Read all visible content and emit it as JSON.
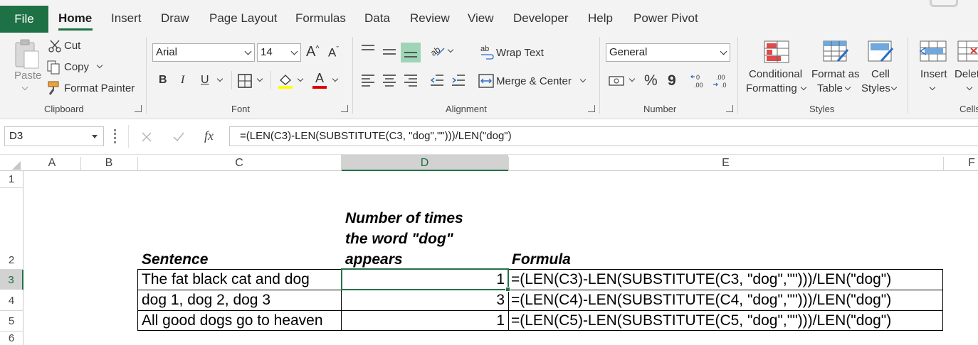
{
  "tabs": [
    "File",
    "Home",
    "Insert",
    "Draw",
    "Page Layout",
    "Formulas",
    "Data",
    "Review",
    "View",
    "Developer",
    "Help",
    "Power Pivot"
  ],
  "ribbon": {
    "clipboard": {
      "paste": "Paste",
      "cut": "Cut",
      "copy": "Copy",
      "format_painter": "Format Painter",
      "label": "Clipboard"
    },
    "font": {
      "name": "Arial",
      "size": "14",
      "bold": "B",
      "italic": "I",
      "underline": "U",
      "font_color_glyph": "A",
      "label": "Font"
    },
    "alignment": {
      "wrap_text": "Wrap Text",
      "merge_center": "Merge & Center",
      "label": "Alignment"
    },
    "number": {
      "format": "General",
      "percent": "%",
      "comma": "9",
      "label": "Number"
    },
    "styles": {
      "conditional_formatting": [
        "Conditional",
        "Formatting"
      ],
      "format_as_table": [
        "Format as",
        "Table"
      ],
      "cell_styles": [
        "Cell",
        "Styles"
      ],
      "label": "Styles"
    },
    "cells": {
      "insert": "Insert",
      "delete": "Delet",
      "label": "Cells"
    }
  },
  "formula_bar": {
    "name_box": "D3",
    "fx": "fx",
    "formula": "=(LEN(C3)-LEN(SUBSTITUTE(C3, \"dog\",\"\")))/LEN(\"dog\")"
  },
  "columns": [
    "A",
    "B",
    "C",
    "D",
    "E",
    "F"
  ],
  "rows": [
    "1",
    "2",
    "3",
    "4",
    "5",
    "6"
  ],
  "sheet": {
    "headers": {
      "sentence": "Sentence",
      "count": [
        "Number of times",
        "the word \"dog\"",
        "appears"
      ],
      "formula": "Formula"
    },
    "data": [
      {
        "sentence": "The fat black cat and dog",
        "count": "1",
        "formula": "=(LEN(C3)-LEN(SUBSTITUTE(C3, \"dog\",\"\")))/LEN(\"dog\")"
      },
      {
        "sentence": "dog 1, dog 2, dog 3",
        "count": "3",
        "formula": "=(LEN(C4)-LEN(SUBSTITUTE(C4, \"dog\",\"\")))/LEN(\"dog\")"
      },
      {
        "sentence": "All good dogs go to heaven",
        "count": "1",
        "formula": "=(LEN(C5)-LEN(SUBSTITUTE(C5, \"dog\",\"\")))/LEN(\"dog\")"
      }
    ]
  },
  "colors": {
    "accent": "#217346",
    "file_tab": "#1e7145",
    "selected_header": "#d2d2d2"
  }
}
